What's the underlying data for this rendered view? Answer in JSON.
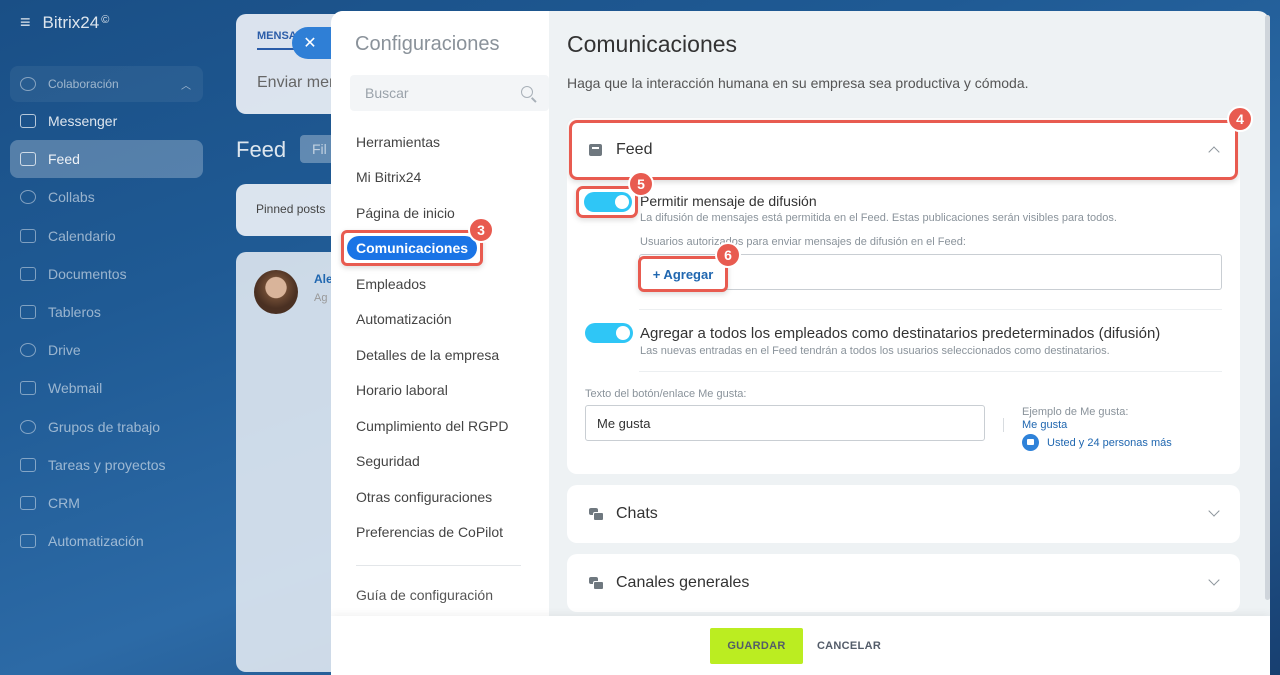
{
  "app": {
    "name": "Bitrix24",
    "logo_suffix": "©"
  },
  "sidebar": {
    "group_label": "Colaboración",
    "items": [
      {
        "label": "Messenger",
        "icon": "chat-icon"
      },
      {
        "label": "Feed",
        "icon": "feed-icon"
      },
      {
        "label": "Collabs",
        "icon": "collabs-icon"
      },
      {
        "label": "Calendario",
        "icon": "calendar-icon"
      },
      {
        "label": "Documentos",
        "icon": "document-icon"
      },
      {
        "label": "Tableros",
        "icon": "board-icon"
      },
      {
        "label": "Drive",
        "icon": "drive-icon"
      },
      {
        "label": "Webmail",
        "icon": "mail-icon"
      },
      {
        "label": "Grupos de trabajo",
        "icon": "group-icon"
      },
      {
        "label": "Tareas y proyectos",
        "icon": "task-icon"
      },
      {
        "label": "CRM",
        "icon": "crm-icon"
      },
      {
        "label": "Automatización",
        "icon": "automation-icon"
      }
    ]
  },
  "bg_main": {
    "tab_label": "MENSA",
    "send_placeholder": "Enviar mer",
    "feed_title": "Feed",
    "filter_label": "Fil",
    "pinned_label": "Pinned posts",
    "author_initials": "Ale",
    "author_sub": "Ag"
  },
  "settings": {
    "nav_title": "Configuraciones",
    "search_placeholder": "Buscar",
    "nav_items": [
      "Herramientas",
      "Mi Bitrix24",
      "Página de inicio",
      "Comunicaciones",
      "Empleados",
      "Automatización",
      "Detalles de la empresa",
      "Horario laboral",
      "Cumplimiento del RGPD",
      "Seguridad",
      "Otras configuraciones",
      "Preferencias de CoPilot"
    ],
    "active_nav": "Comunicaciones",
    "guide_label": "Guía de configuración"
  },
  "content": {
    "title": "Comunicaciones",
    "subtitle": "Haga que la interacción humana en su empresa sea productiva y cómoda.",
    "feed": {
      "label": "Feed",
      "broadcast": {
        "label": "Permitir mensaje de difusión",
        "desc": "La difusión de mensajes está permitida en el Feed. Estas publicaciones serán visibles para todos.",
        "enabled": true
      },
      "users_label": "Usuarios autorizados para enviar mensajes de difusión en el Feed:",
      "add_button": "+ Agregar",
      "default_recipients": {
        "label": "Agregar a todos los empleados como destinatarios predeterminados (difusión)",
        "desc": "Las nuevas entradas en el Feed tendrán a todos los usuarios seleccionados como destinatarios.",
        "enabled": true
      },
      "like_text_label": "Texto del botón/enlace Me gusta:",
      "like_text_value": "Me gusta",
      "example_title": "Ejemplo de Me gusta:",
      "example_like": "Me gusta",
      "example_people": "Usted y 24 personas más"
    },
    "chats_label": "Chats",
    "canales_label": "Canales generales"
  },
  "footer": {
    "save": "GUARDAR",
    "cancel": "CANCELAR"
  },
  "annotations": [
    "3",
    "4",
    "5",
    "6"
  ],
  "colors": {
    "accent": "#1a74e6",
    "toggle": "#2fc6f6",
    "save": "#bbed21",
    "callout": "#e85b50"
  }
}
